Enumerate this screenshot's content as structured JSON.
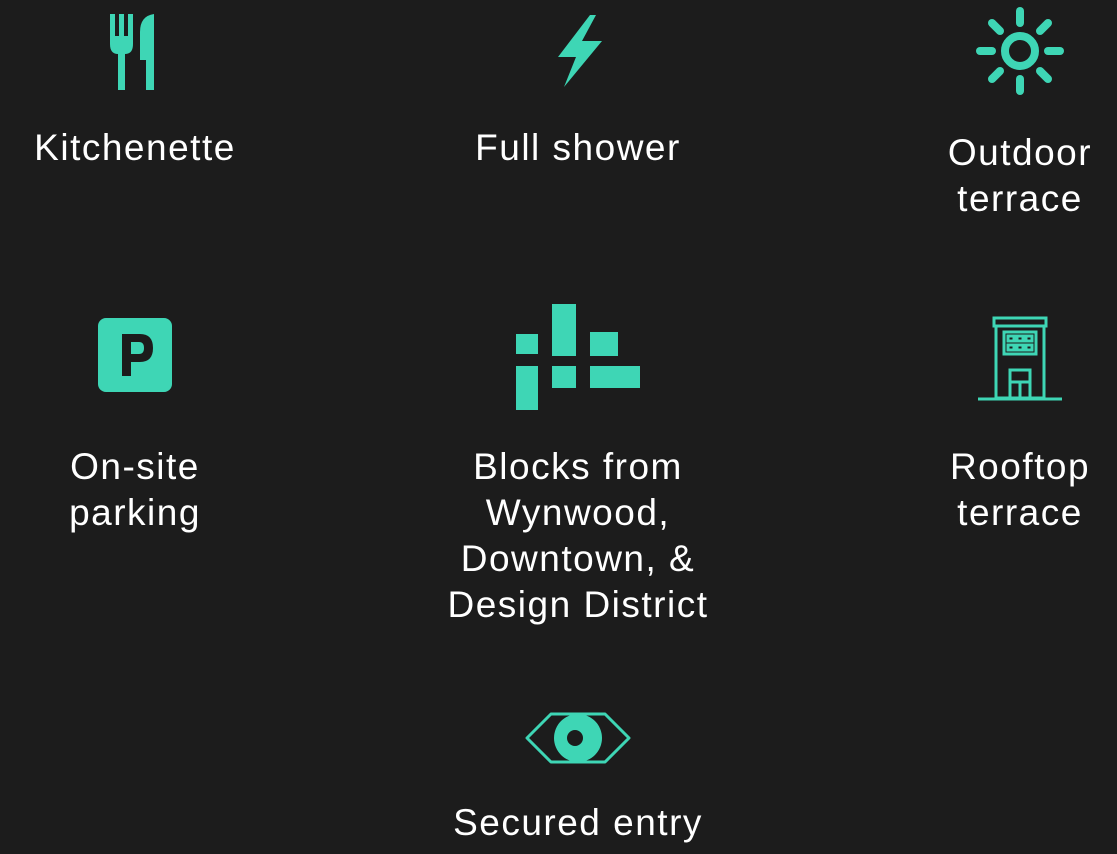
{
  "accent_color": "#3ed6b5",
  "background_color": "#1c1c1c",
  "text_color": "#ffffff",
  "amenities": [
    {
      "icon": "fork-knife-icon",
      "label": "Kitchenette"
    },
    {
      "icon": "lightning-bolt-icon",
      "label": "Full shower"
    },
    {
      "icon": "sun-icon",
      "label": "Outdoor\nterrace"
    },
    {
      "icon": "parking-sign-icon",
      "label": "On-site\nparking"
    },
    {
      "icon": "city-blocks-icon",
      "label": "Blocks from\nWynwood,\nDowntown, &\nDesign District"
    },
    {
      "icon": "building-icon",
      "label": "Rooftop\nterrace"
    },
    {
      "icon": "eye-icon",
      "label": "Secured entry"
    }
  ]
}
